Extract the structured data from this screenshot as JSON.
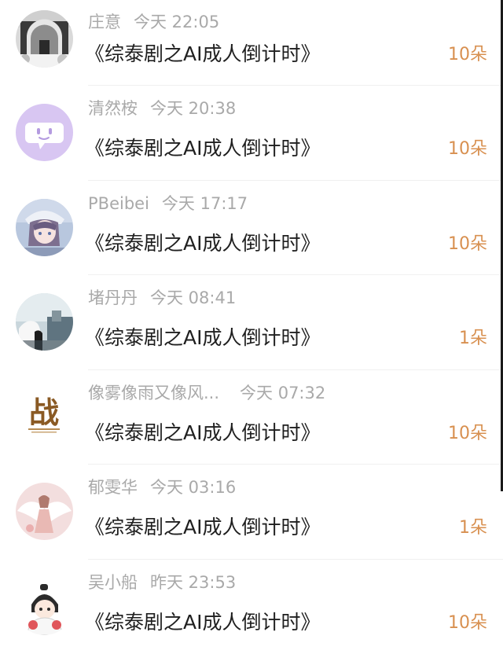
{
  "rows": [
    {
      "user": "庄意",
      "time": "今天 22:05",
      "title": "《综泰剧之AI成人倒计时》",
      "count": "10朵",
      "avatar_icon": "gate-scene-avatar-icon"
    },
    {
      "user": "清然桉",
      "time": "今天 20:38",
      "title": "《综泰剧之AI成人倒计时》",
      "count": "10朵",
      "avatar_icon": "chat-bubble-avatar-icon"
    },
    {
      "user": "PBeibei",
      "time": "今天 17:17",
      "title": "《综泰剧之AI成人倒计时》",
      "count": "10朵",
      "avatar_icon": "anime-girl-avatar-icon"
    },
    {
      "user": "堵丹丹",
      "time": "今天 08:41",
      "title": "《综泰剧之AI成人倒计时》",
      "count": "1朵",
      "avatar_icon": "photo-person-avatar-icon"
    },
    {
      "user": "像雾像雨又像风...",
      "time": "今天 07:32",
      "title": "《综泰剧之AI成人倒计时》",
      "count": "10朵",
      "avatar_icon": "calligraphy-avatar-icon"
    },
    {
      "user": "郁雯华",
      "time": "今天 03:16",
      "title": "《综泰剧之AI成人倒计时》",
      "count": "1朵",
      "avatar_icon": "angel-wings-avatar-icon"
    },
    {
      "user": "吴小船",
      "time": "昨天 23:53",
      "title": "《综泰剧之AI成人倒计时》",
      "count": "10朵",
      "avatar_icon": "chibi-avatar-icon"
    }
  ],
  "avatar5_glyph": "战",
  "colors": {
    "username": "#a9a9a9",
    "title": "#1f1f1f",
    "count": "#d89050",
    "divider": "#f0f0f0"
  }
}
